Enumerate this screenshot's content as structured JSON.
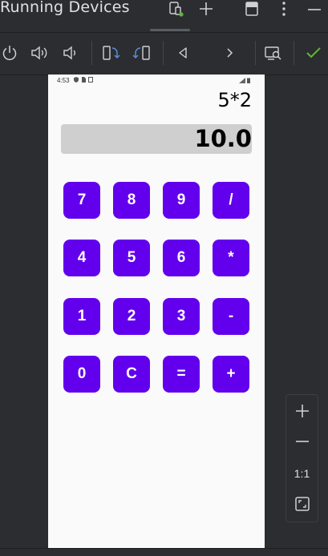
{
  "window": {
    "title": "Running Devices"
  },
  "toolbar": {
    "icons": [
      "power-icon",
      "volume-up-icon",
      "volume-down-icon",
      "rotate-left-icon",
      "rotate-right-icon",
      "back-icon",
      "forward-icon",
      "screenshot-icon",
      "check-icon"
    ]
  },
  "device": {
    "status_time": "4:53",
    "expression": "5*2",
    "result": "10.0",
    "keys": [
      [
        "7",
        "8",
        "9",
        "/"
      ],
      [
        "4",
        "5",
        "6",
        "*"
      ],
      [
        "1",
        "2",
        "3",
        "-"
      ],
      [
        "0",
        "C",
        "=",
        "+"
      ]
    ]
  },
  "zoom": {
    "actual_size_label": "1:1"
  },
  "colors": {
    "accent": "#6200ee",
    "result_bg": "#cfcfcf",
    "ide_bg": "#2b2d30",
    "check": "#5fb832"
  }
}
